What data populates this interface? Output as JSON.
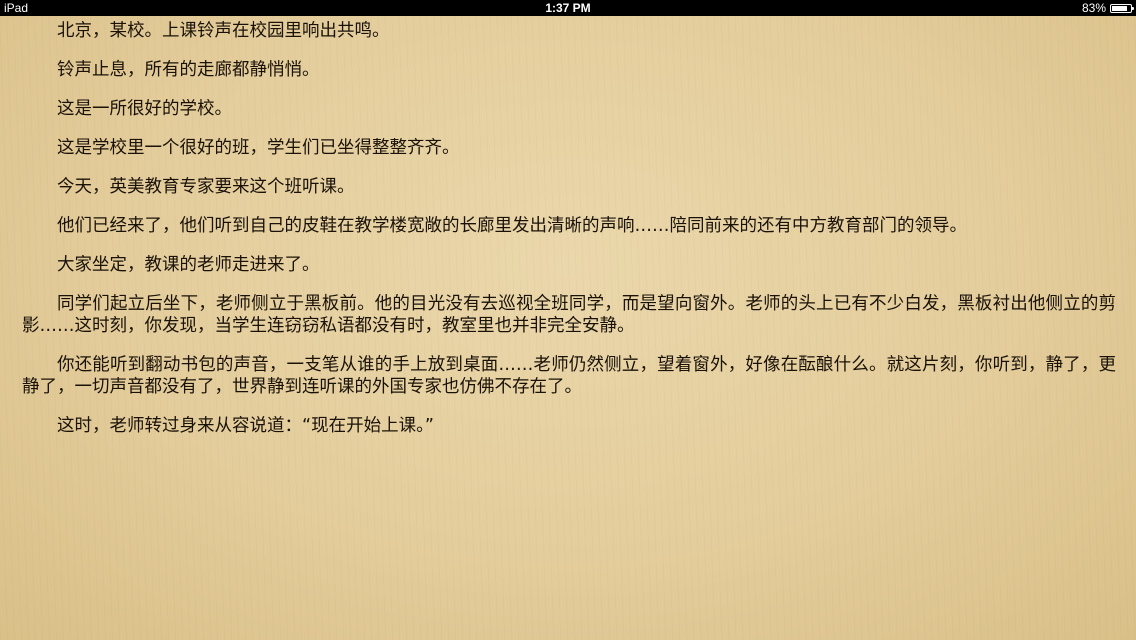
{
  "status_bar": {
    "device": "iPad",
    "time": "1:37 PM",
    "battery_percent": "83%",
    "battery_level": 0.83
  },
  "reader": {
    "paragraphs": [
      "北京，某校。上课铃声在校园里响出共鸣。",
      "铃声止息，所有的走廊都静悄悄。",
      "这是一所很好的学校。",
      "这是学校里一个很好的班，学生们已坐得整整齐齐。",
      "今天，英美教育专家要来这个班听课。",
      "他们已经来了，他们听到自己的皮鞋在教学楼宽敞的长廊里发出清晰的声响……陪同前来的还有中方教育部门的领导。",
      "大家坐定，教课的老师走进来了。",
      "同学们起立后坐下，老师侧立于黑板前。他的目光没有去巡视全班同学，而是望向窗外。老师的头上已有不少白发，黑板衬出他侧立的剪影……这时刻，你发现，当学生连窃窃私语都没有时，教室里也并非完全安静。",
      "你还能听到翻动书包的声音，一支笔从谁的手上放到桌面……老师仍然侧立，望着窗外，好像在酝酿什么。就这片刻，你听到，静了，更静了，一切声音都没有了，世界静到连听课的外国专家也仿佛不存在了。",
      "这时，老师转过身来从容说道：“现在开始上课。”"
    ]
  }
}
